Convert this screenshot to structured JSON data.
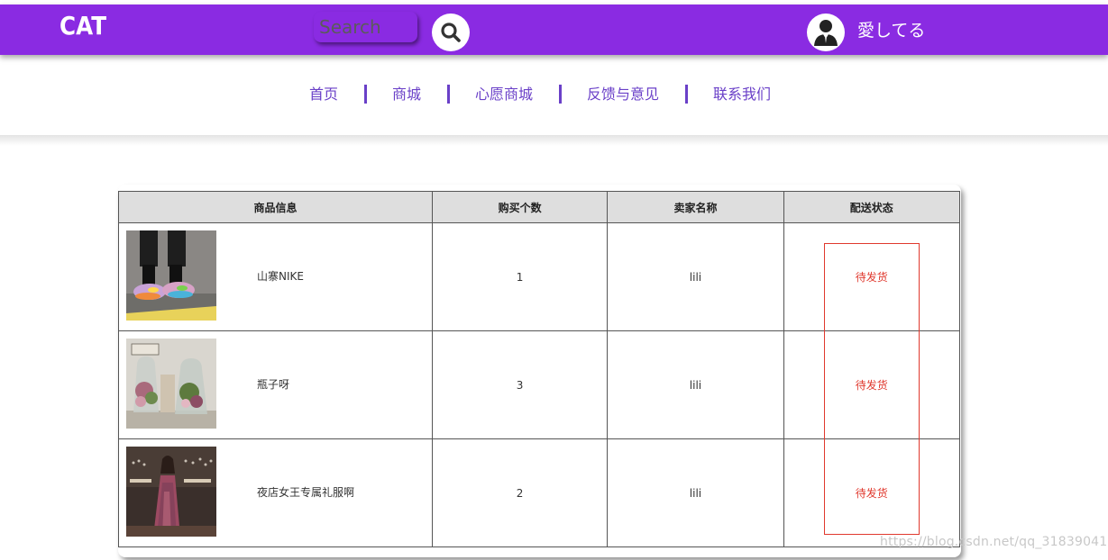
{
  "header": {
    "brand": "CAT",
    "search_placeholder": "Search",
    "username": "愛してる",
    "brand_color": "#8a2be2"
  },
  "nav": {
    "items": [
      {
        "label": "首页"
      },
      {
        "label": "商城"
      },
      {
        "label": "心愿商城"
      },
      {
        "label": "反馈与意见"
      },
      {
        "label": "联系我们"
      }
    ],
    "color": "#6a40c8"
  },
  "orders": {
    "columns": [
      "商品信息",
      "购买个数",
      "卖家名称",
      "配送状态"
    ],
    "rows": [
      {
        "product": "山寨NIKE",
        "quantity": "1",
        "seller": "lili",
        "status": "待发货",
        "image": "sneakers-photo"
      },
      {
        "product": "瓶子呀",
        "quantity": "3",
        "seller": "lili",
        "status": "待发货",
        "image": "glass-bottles-photo"
      },
      {
        "product": "夜店女王专属礼服啊",
        "quantity": "2",
        "seller": "lili",
        "status": "待发货",
        "image": "dress-photo"
      }
    ],
    "status_color": "#e0392e"
  },
  "watermark": "https://blog.csdn.net/qq_31839041"
}
